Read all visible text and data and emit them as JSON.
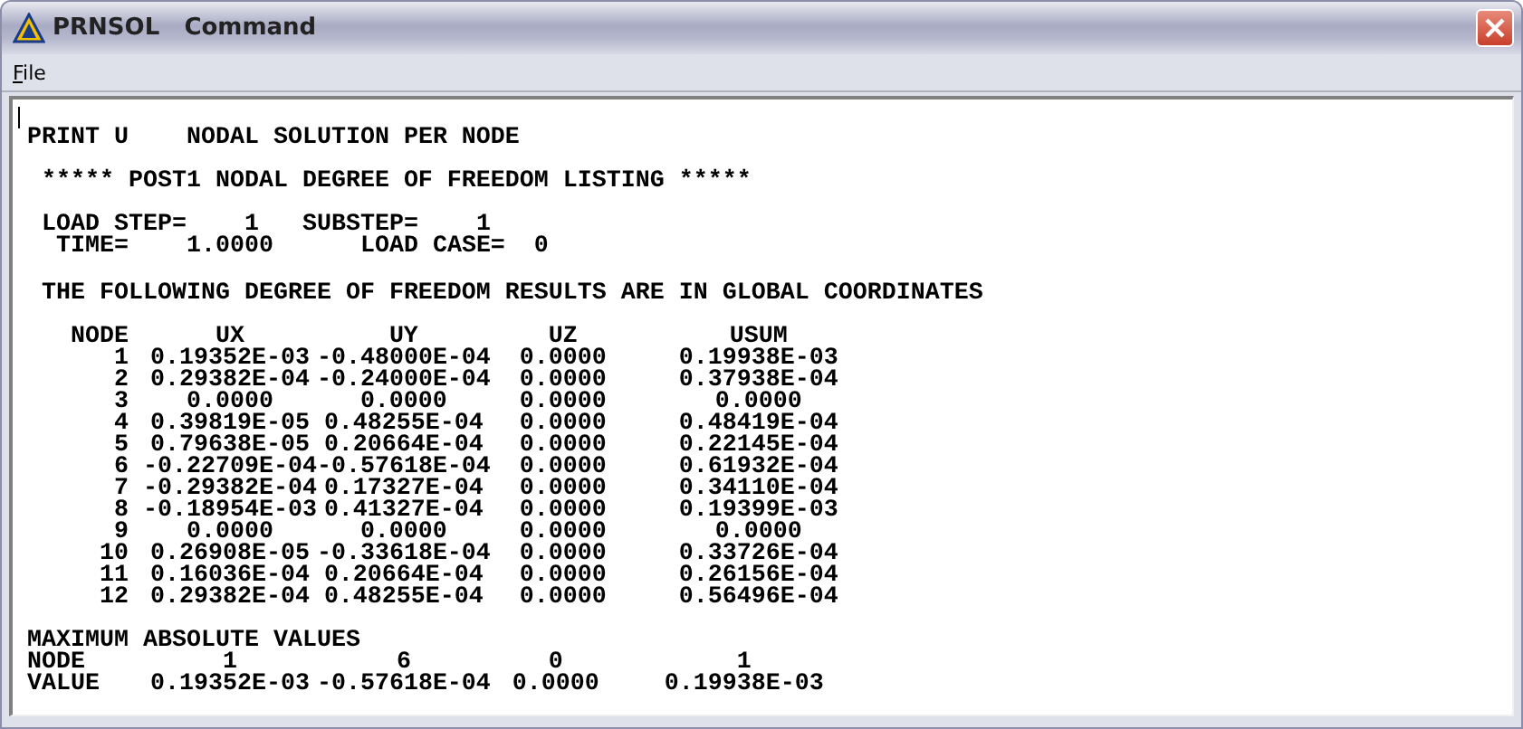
{
  "window": {
    "title": "PRNSOL   Command"
  },
  "menu": [
    {
      "label": "File"
    }
  ],
  "output": {
    "header": [
      "PRINT U",
      "NODAL SOLUTION PER NODE"
    ],
    "banner": "***** POST1 NODAL DEGREE OF FREEDOM LISTING *****",
    "step_line": [
      "LOAD STEP=",
      "1",
      "SUBSTEP=",
      "1"
    ],
    "time_line": [
      "TIME=",
      "1.0000",
      "LOAD CASE=",
      "0"
    ],
    "note": "THE FOLLOWING DEGREE OF FREEDOM RESULTS ARE IN GLOBAL COORDINATES",
    "table": {
      "columns": [
        "NODE",
        "UX",
        "UY",
        "UZ",
        "USUM"
      ],
      "rows": [
        [
          "1",
          "0.19352E-03",
          "-0.48000E-04",
          "0.0000",
          "0.19938E-03"
        ],
        [
          "2",
          "0.29382E-04",
          "-0.24000E-04",
          "0.0000",
          "0.37938E-04"
        ],
        [
          "3",
          "0.0000",
          "0.0000",
          "0.0000",
          "0.0000"
        ],
        [
          "4",
          "0.39819E-05",
          "0.48255E-04",
          "0.0000",
          "0.48419E-04"
        ],
        [
          "5",
          "0.79638E-05",
          "0.20664E-04",
          "0.0000",
          "0.22145E-04"
        ],
        [
          "6",
          "-0.22709E-04",
          "-0.57618E-04",
          "0.0000",
          "0.61932E-04"
        ],
        [
          "7",
          "-0.29382E-04",
          "0.17327E-04",
          "0.0000",
          "0.34110E-04"
        ],
        [
          "8",
          "-0.18954E-03",
          "0.41327E-04",
          "0.0000",
          "0.19399E-03"
        ],
        [
          "9",
          "0.0000",
          "0.0000",
          "0.0000",
          "0.0000"
        ],
        [
          "10",
          "0.26908E-05",
          "-0.33618E-04",
          "0.0000",
          "0.33726E-04"
        ],
        [
          "11",
          "0.16036E-04",
          "0.20664E-04",
          "0.0000",
          "0.26156E-04"
        ],
        [
          "12",
          "0.29382E-04",
          "0.48255E-04",
          "0.0000",
          "0.56496E-04"
        ]
      ]
    },
    "maximum": {
      "title": "MAXIMUM ABSOLUTE VALUES",
      "rows": [
        [
          "NODE",
          "1",
          "6",
          "0",
          "1"
        ],
        [
          "VALUE",
          "0.19352E-03",
          "-0.57618E-04",
          "0.0000",
          "0.19938E-03"
        ]
      ]
    }
  }
}
